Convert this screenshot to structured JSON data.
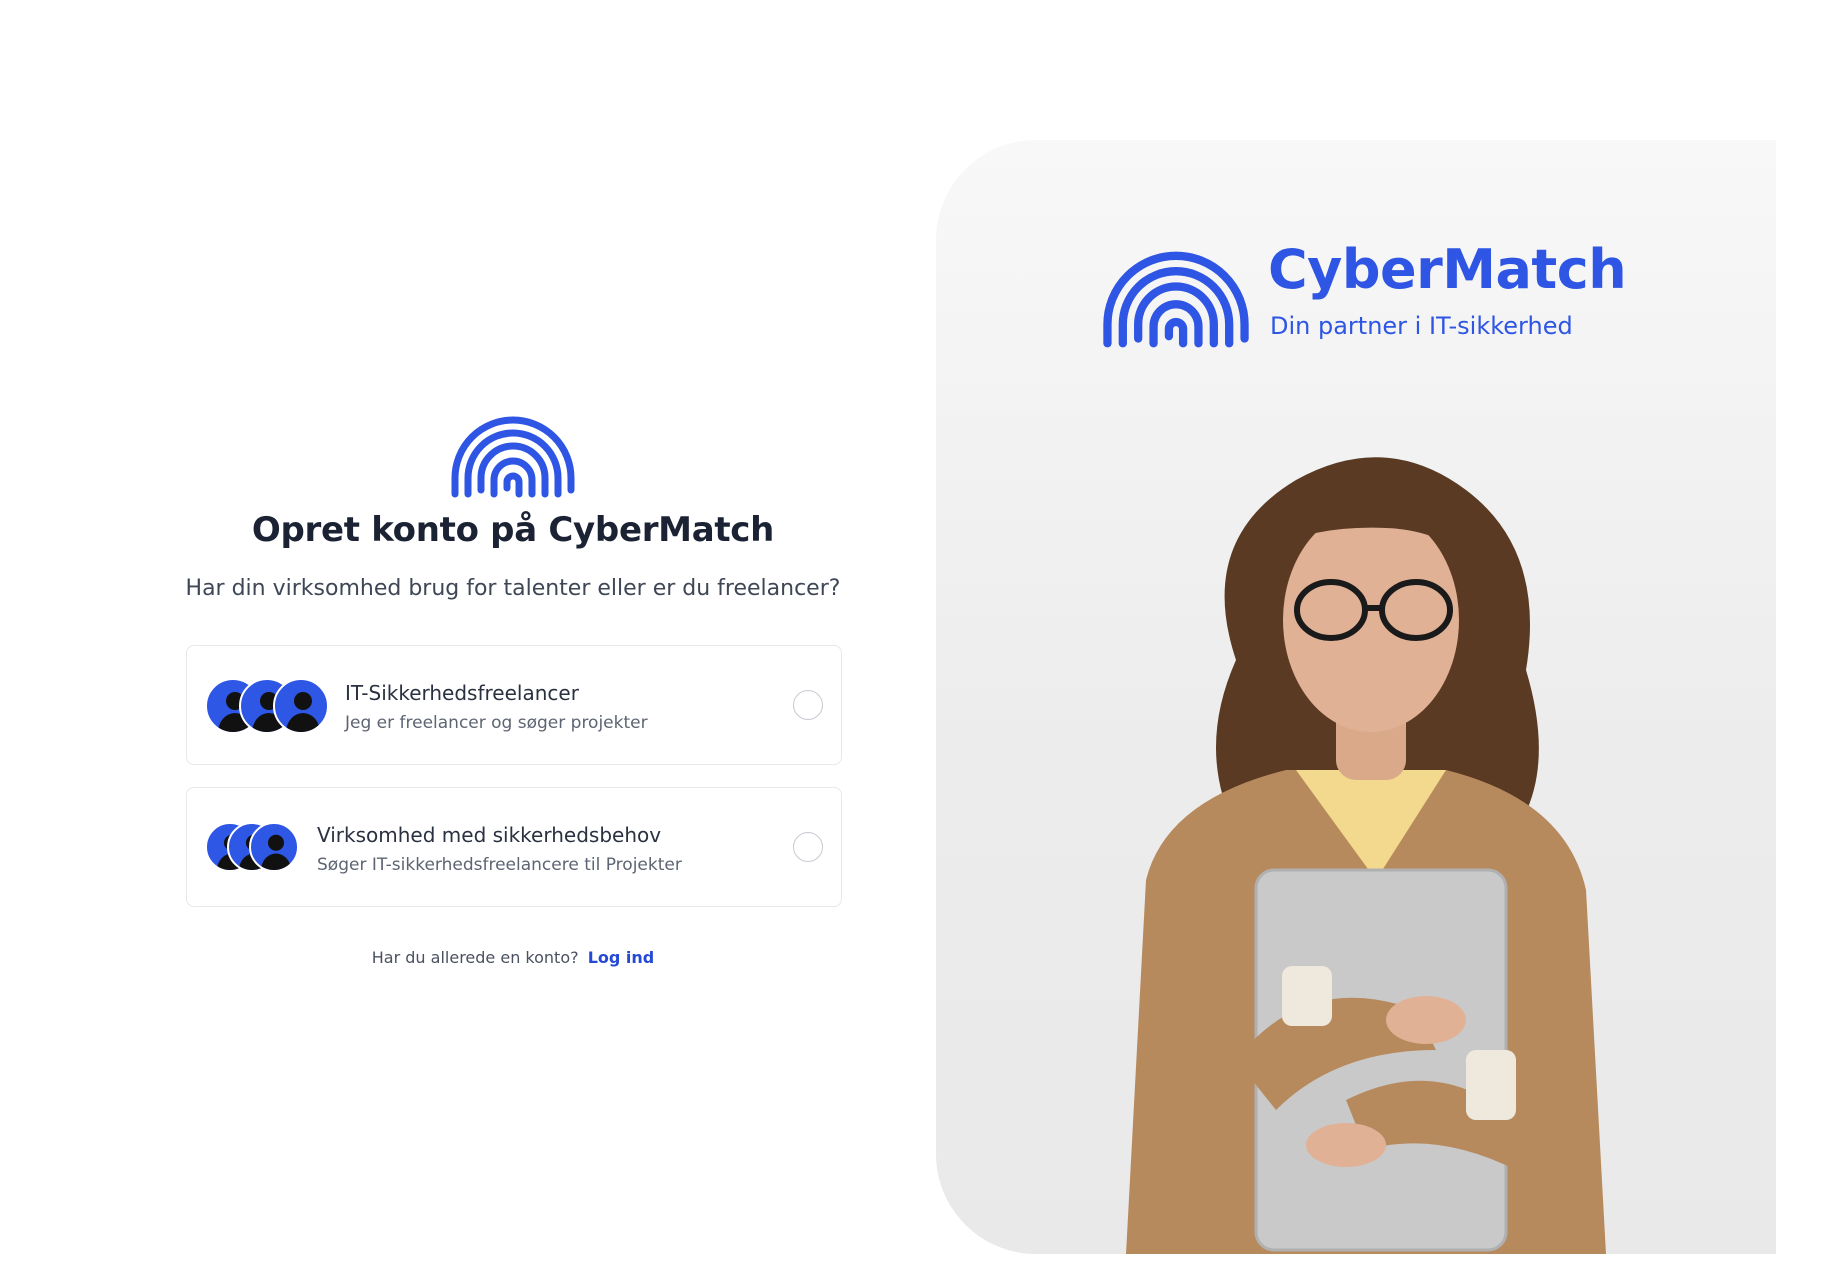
{
  "signup": {
    "title": "Opret konto på CyberMatch",
    "subtitle": "Har din virksomhed brug for talenter eller er du freelancer?",
    "options": [
      {
        "title": "IT-Sikkerhedsfreelancer",
        "description": "Jeg er freelancer og søger projekter",
        "selected": false
      },
      {
        "title": "Virksomhed med sikkerhedsbehov",
        "description": "Søger IT-sikkerhedsfreelancere til Projekter",
        "selected": false
      }
    ],
    "login_prompt": "Har du allerede en konto?",
    "login_link": "Log ind"
  },
  "brand": {
    "name": "CyberMatch",
    "tagline": "Din partner i IT-sikkerhed",
    "logo_icon": "fingerprint-arch-icon"
  },
  "colors": {
    "brand_blue": "#2e55e3",
    "link_blue": "#2449d6",
    "avatar_blue": "#2e57e6",
    "text_dark": "#1b2233"
  }
}
